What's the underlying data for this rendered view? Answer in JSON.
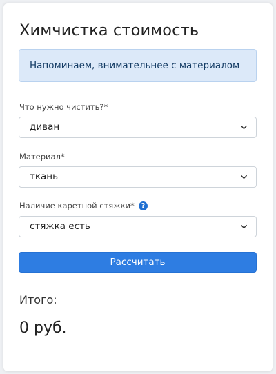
{
  "form": {
    "title": "Химчистка стоимость",
    "notice": "Напоминаем, внимательнее с материалом",
    "fields": [
      {
        "label": "Что нужно чистить?*",
        "value": "диван"
      },
      {
        "label": "Материал*",
        "value": "ткань"
      },
      {
        "label": "Наличие каретной стяжки*",
        "value": "стяжка есть"
      }
    ],
    "help_icon": "question-circle-icon",
    "help_glyph": "?",
    "submit_label": "Рассчитать",
    "total_label": "Итого:",
    "total_value": "0 руб."
  },
  "colors": {
    "accent": "#2e7de2",
    "notice_bg": "#dce9f9",
    "help_icon": "#1f6fd1"
  }
}
